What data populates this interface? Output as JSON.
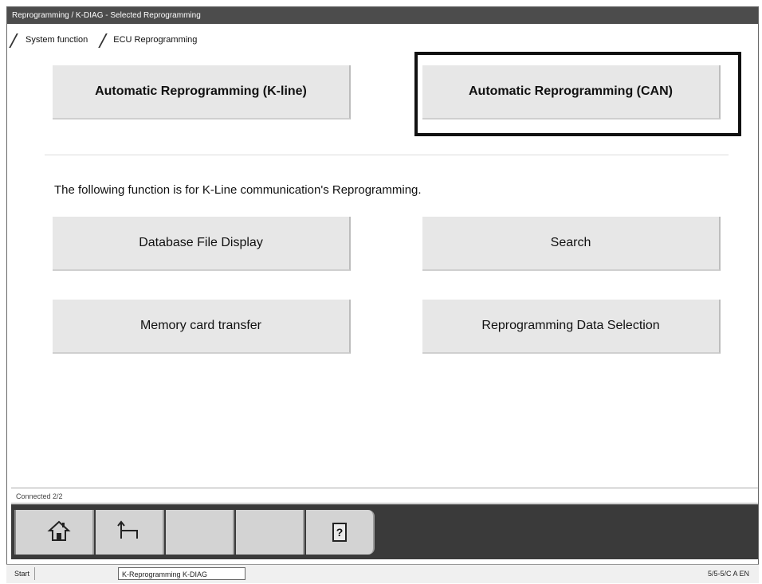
{
  "window": {
    "title": "Reprogramming / K-DIAG - Selected Reprogramming"
  },
  "breadcrumb": {
    "items": [
      "System function",
      "ECU Reprogramming"
    ]
  },
  "buttons": {
    "auto_kline": "Automatic Reprogramming (K-line)",
    "auto_can": "Automatic Reprogramming (CAN)",
    "database_file_display": "Database File Display",
    "search": "Search",
    "memory_card_transfer": "Memory card transfer",
    "reprogramming_data_selection": "Reprogramming Data Selection"
  },
  "instruction_text": "The following function is for K-Line communication's Reprogramming.",
  "status_line": "Connected 2/2",
  "toolbar": {
    "help_label": "?"
  },
  "taskbar": {
    "start_label": "Start",
    "task_item": "K-Reprogramming K-DIAG",
    "tray_text": "5/5-5/C  A  EN"
  },
  "icons": [
    "home-icon",
    "back-icon",
    "help-icon"
  ]
}
